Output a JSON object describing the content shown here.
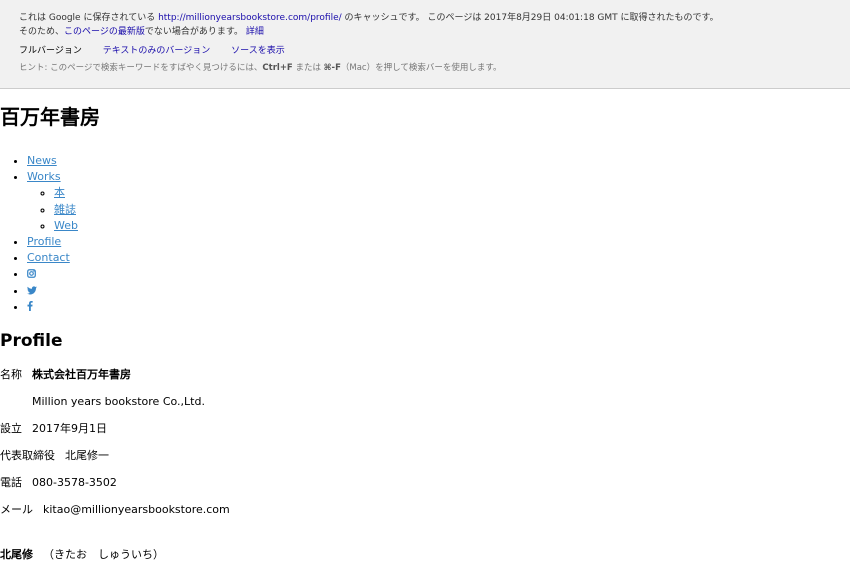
{
  "cache": {
    "line1_prefix": "これは Google に保存されている ",
    "line1_url": "http://millionyearsbookstore.com/profile/",
    "line1_suffix": " のキャッシュです。 このページは 2017年8月29日 04:01:18 GMT に取得されたものです。",
    "line2_prefix": "そのため、",
    "line2_link": "このページの最新版",
    "line2_suffix": "でない場合があります。 ",
    "line2_detail": "詳細",
    "version_full": "フルバージョン",
    "version_text": "テキストのみのバージョン",
    "view_source": "ソースを表示",
    "hint_prefix": "ヒント: このページで検索キーワードをすばやく見つけるには、",
    "hint_key1": "Ctrl+F",
    "hint_mid": " または ",
    "hint_key2": "⌘-F",
    "hint_suffix": "（Mac）を押して検索バーを使用します。"
  },
  "site": {
    "title": "百万年書房"
  },
  "nav": {
    "news": "News",
    "works": "Works",
    "works_sub": [
      "本",
      "雑誌",
      "Web"
    ],
    "profile": "Profile",
    "contact": "Contact",
    "icons": [
      "instagram-icon",
      "twitter-icon",
      "facebook-icon"
    ]
  },
  "section": {
    "title": "Profile"
  },
  "profile": {
    "name_label": "名称",
    "name_value": "株式会社百万年書房",
    "name_en": "Million years bookstore Co.,Ltd.",
    "founded_label": "設立",
    "founded_value": "2017年9月1日",
    "ceo_label": "代表取締役",
    "ceo_value": "北尾修一",
    "phone_label": "電話",
    "phone_value": "080-3578-3502",
    "mail_label": "メール",
    "mail_value": "kitao@millionyearsbookstore.com",
    "cutoff_label": "北尾修",
    "cutoff_value": "（きたお　しゅういち）"
  }
}
